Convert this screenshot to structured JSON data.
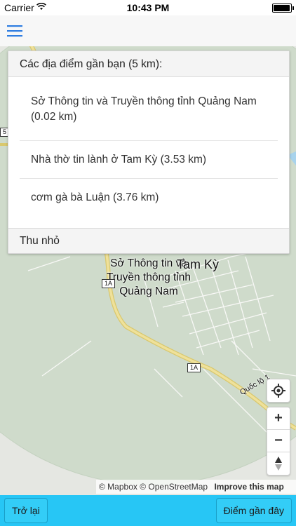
{
  "status": {
    "carrier": "Carrier",
    "time": "10:43 PM",
    "battery_level": 0.95
  },
  "nav": {
    "menu_icon": "hamburger-menu-icon"
  },
  "panel": {
    "header": "Các địa điểm gần bạn (5 km):",
    "items": [
      {
        "label": "Sở Thông tin và Truyền thông tỉnh Quảng Nam (0.02 km)"
      },
      {
        "label": "Nhà thờ tin lành ở Tam Kỳ (3.53 km)"
      },
      {
        "label": "cơm gà bà Luận (3.76 km)"
      }
    ],
    "footer": "Thu nhỏ"
  },
  "map": {
    "place_label": "Sở Thông tin và Truyền thông tỉnh Quảng Nam",
    "city_label": "Tam Kỳ",
    "road_1a_a": "1A",
    "road_1a_b": "1A",
    "road_5": "5",
    "road_quoc_lo": "Quốc lộ 1",
    "locate_icon": "crosshair-locate-icon",
    "zoom_in": "+",
    "zoom_out": "−",
    "compass_icon": "compass-icon"
  },
  "attribution": {
    "mapbox": "© Mapbox",
    "osm": "© OpenStreetMap",
    "improve": "Improve this map"
  },
  "bottom": {
    "back_label": "Trở lại",
    "nearby_label": "Điểm gần đây"
  },
  "colors": {
    "bottom_bar": "#27c6f5",
    "menu_icon": "#2f7de1",
    "map_circle": "#cbd8c7",
    "road_major": "#e6d47a"
  }
}
